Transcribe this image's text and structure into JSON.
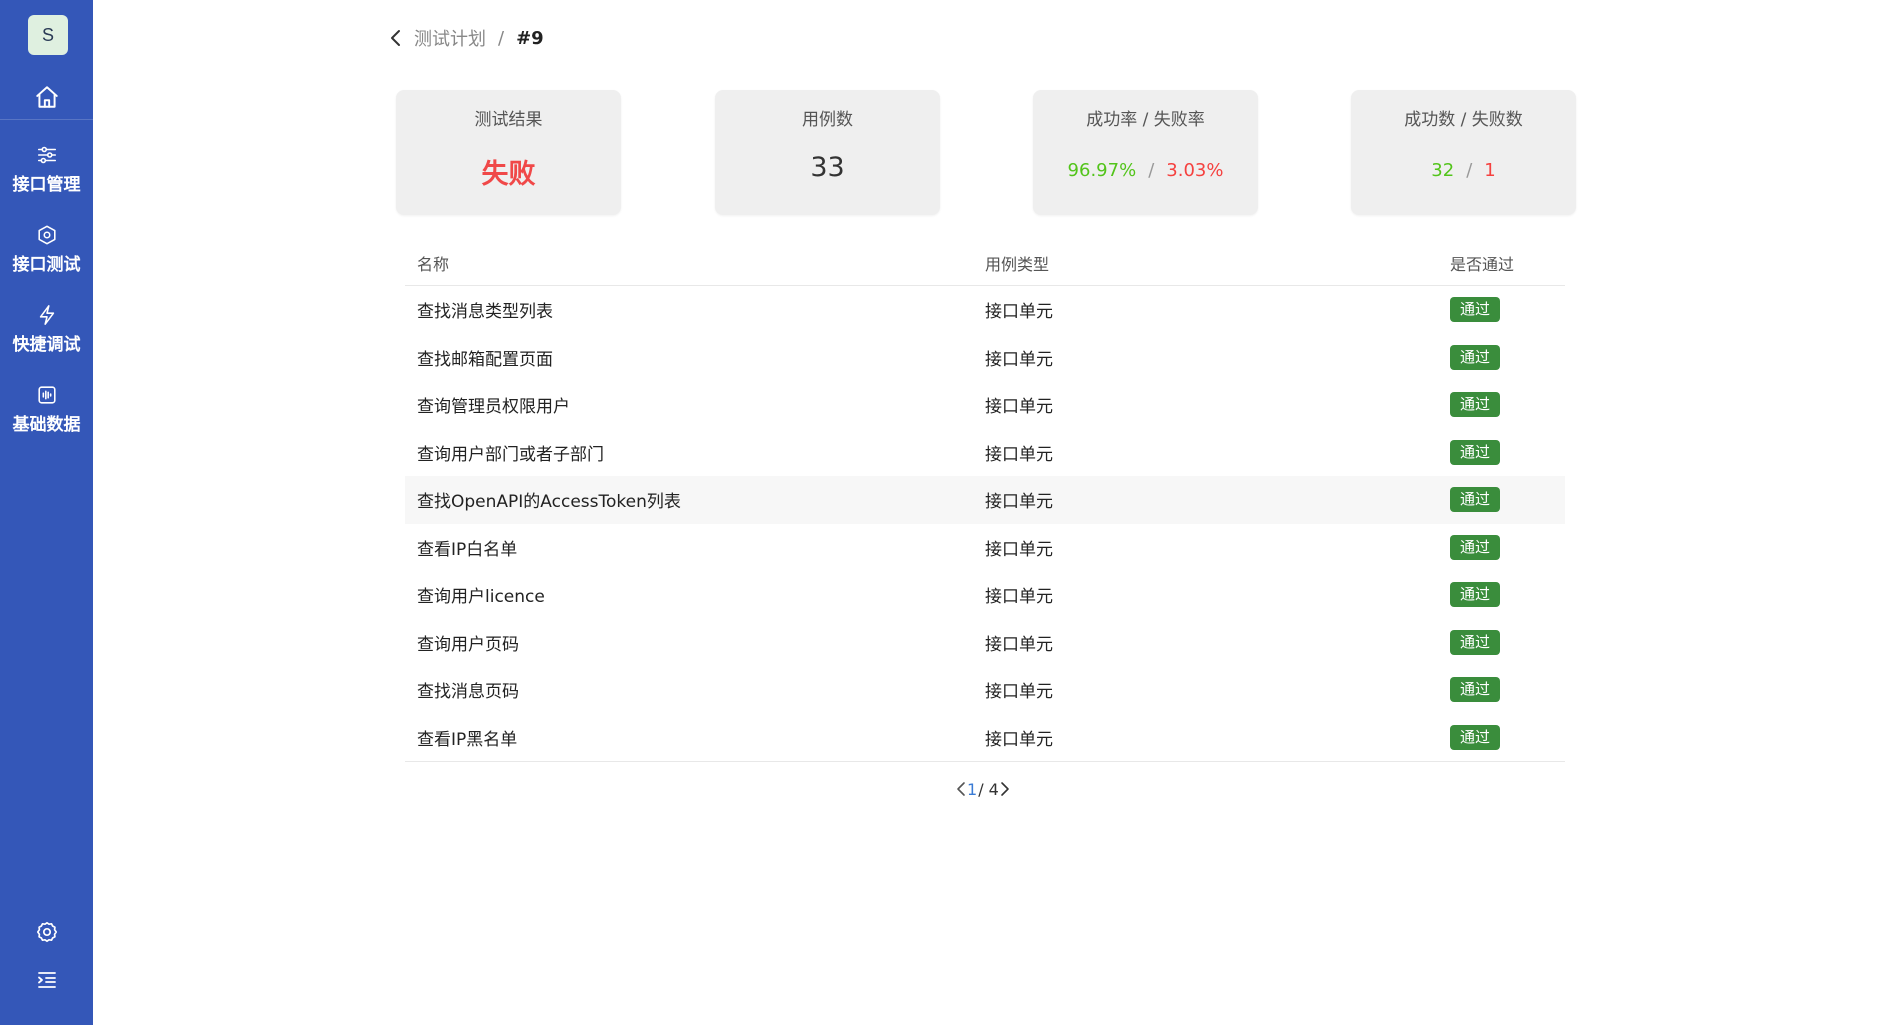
{
  "sidebar": {
    "avatar_letter": "S",
    "home_icon": "home-icon",
    "items": [
      {
        "label": "接口管理",
        "icon": "sliders-icon"
      },
      {
        "label": "接口测试",
        "icon": "hexagon-gear-icon"
      },
      {
        "label": "快捷调试",
        "icon": "lightning-icon"
      },
      {
        "label": "基础数据",
        "icon": "waveform-box-icon"
      }
    ],
    "settings_icon": "gear-icon",
    "collapse_icon": "menu-collapse-icon"
  },
  "breadcrumb": {
    "parent": "测试计划",
    "separator": "/",
    "current": "#9"
  },
  "cards": {
    "result": {
      "title": "测试结果",
      "value": "失败"
    },
    "cases": {
      "title": "用例数",
      "value": "33"
    },
    "rate": {
      "title": "成功率 / 失败率",
      "success": "96.97%",
      "fail": "3.03%",
      "sep": "/"
    },
    "count": {
      "title": "成功数 / 失败数",
      "success": "32",
      "fail": "1",
      "sep": "/"
    }
  },
  "table": {
    "headers": {
      "name": "名称",
      "type": "用例类型",
      "pass": "是否通过"
    },
    "rows": [
      {
        "name": "查找消息类型列表",
        "type": "接口单元",
        "status": "通过"
      },
      {
        "name": "查找邮箱配置页面",
        "type": "接口单元",
        "status": "通过"
      },
      {
        "name": "查询管理员权限用户",
        "type": "接口单元",
        "status": "通过"
      },
      {
        "name": "查询用户部门或者子部门",
        "type": "接口单元",
        "status": "通过"
      },
      {
        "name": "查找OpenAPI的AccessToken列表",
        "type": "接口单元",
        "status": "通过"
      },
      {
        "name": "查看IP白名单",
        "type": "接口单元",
        "status": "通过"
      },
      {
        "name": "查询用户licence",
        "type": "接口单元",
        "status": "通过"
      },
      {
        "name": "查询用户页码",
        "type": "接口单元",
        "status": "通过"
      },
      {
        "name": "查找消息页码",
        "type": "接口单元",
        "status": "通过"
      },
      {
        "name": "查看IP黑名单",
        "type": "接口单元",
        "status": "通过"
      }
    ]
  },
  "pagination": {
    "current": "1",
    "total": "/ 4"
  },
  "colors": {
    "sidebar": "#3457b8",
    "success": "#52c41a",
    "fail": "#f5413f",
    "badge": "#3a8d3c",
    "page_active": "#3a7bd5"
  }
}
